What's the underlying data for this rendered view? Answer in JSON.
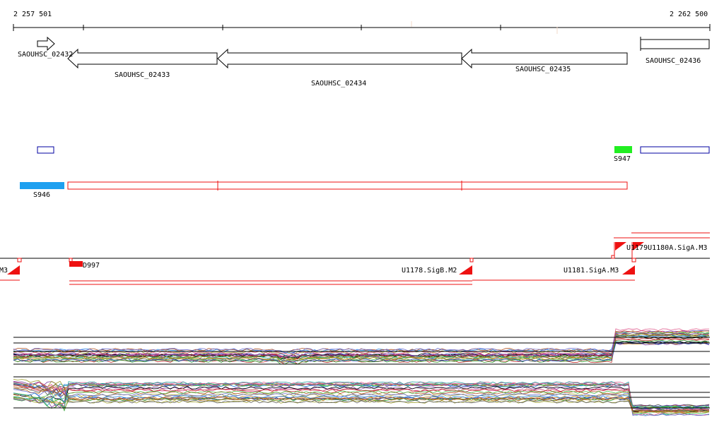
{
  "ruler": {
    "start_label": "2 257 501",
    "end_label": "2 262 500"
  },
  "genes": {
    "g1": "SAOUHSC_02432",
    "g2": "SAOUHSC_02433",
    "g3": "SAOUHSC_02434",
    "g4": "SAOUHSC_02435",
    "g5": "SAOUHSC_02436"
  },
  "segments": {
    "s946": "S946",
    "s947": "S947"
  },
  "features": {
    "d997": "D997",
    "m3_left": "M3",
    "u1178": "U1178.SigB.M2",
    "u1181": "U1181.SigA.M3",
    "u_right": "U1179U1180A.SigA.M3"
  },
  "colors": {
    "gene_outline": "#000000",
    "segment_blue": "#0000a0",
    "segment_cyan": "#1ea0f0",
    "segment_green": "#22ee22",
    "feature_red": "#ee1111"
  }
}
